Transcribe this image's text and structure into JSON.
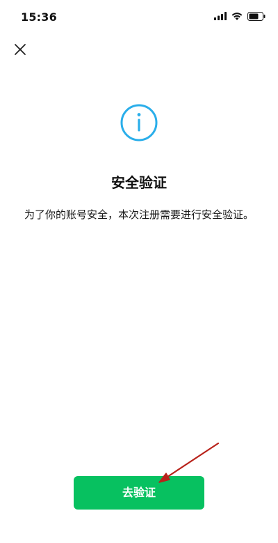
{
  "status_bar": {
    "time": "15:36",
    "icons": [
      "signal-icon",
      "wifi-icon",
      "battery-icon"
    ]
  },
  "header": {
    "close_icon": "close-icon"
  },
  "content": {
    "icon": "info-icon",
    "title": "安全验证",
    "description": "为了你的账号安全，本次注册需要进行安全验证。"
  },
  "actions": {
    "verify_label": "去验证"
  },
  "colors": {
    "accent_green": "#07c160",
    "info_blue": "#2aaeea",
    "annotation_red": "#b8221a"
  }
}
